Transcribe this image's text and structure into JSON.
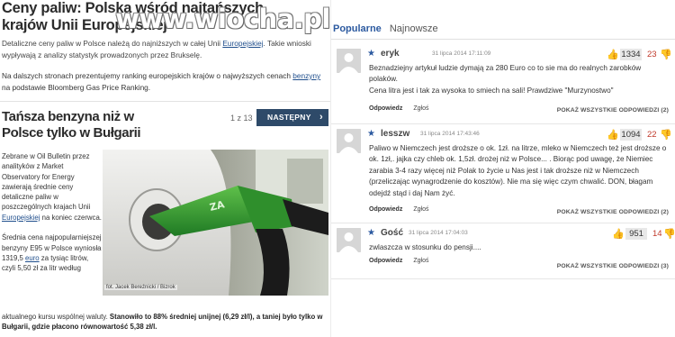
{
  "article": {
    "title": "Ceny paliw: Polska wśród najtańszych krajów Unii Europejskiej",
    "lead_pre": "Detaliczne ceny paliw w Polsce należą do najniższych w całej Unii ",
    "lead_link": "Europejskiej",
    "lead_post": ". Takie wnioski wypływają z analizy statystyk prowadzonych przez Brukselę.",
    "lead2_pre": "Na dalszych stronach prezentujemy ranking europejskich krajów o najwyższych cenach ",
    "lead2_link": "benzyny",
    "lead2_post": " na podstawie Bloomberg Gas Price Ranking.",
    "subtitle": "Tańsza benzyna niż w Polsce tylko w Bułgarii",
    "pager": "1 z 13",
    "next_label": "NASTĘPNY",
    "next_chevron": "›",
    "side_text_1": "Zebrane w Oil Bulletin przez analityków z Market Observatory for Energy zawierają średnie ceny detaliczne paliw w poszczególnych krajach Unii ",
    "side_link": "Europejskiej",
    "side_text_2": " na koniec czerwca.",
    "side_text_3": "Średnia cena najpopularniejszej benzyny E95 w Polsce wyniosła 1319,5 ",
    "side_link_2": "euro",
    "side_text_4": " za tysiąc litrów, czyli 5,50 zł za litr według",
    "bottom_pre": "aktualnego kursu wspólnej waluty. ",
    "bottom_bold": "Stanowiło to 88% średniej unijnej (6,29 zł/l), a taniej było tylko w Bułgarii, gdzie płacono równowartość 5,38 zł/l.",
    "photo_credit": "fot. Jacek Bereźnicki / Bizrok",
    "nozzle_brand": "ZA"
  },
  "watermark": "www.wiocha.pl",
  "comments_panel": {
    "tabs": [
      {
        "label": "Popularne"
      },
      {
        "label": "Najnowsze"
      }
    ],
    "reply_label": "Odpowiedz",
    "report_label": "Zgłoś",
    "show_all_label": "POKAŻ WSZYSTKIE ODPOWIEDZI",
    "comments": [
      {
        "star": "★",
        "author": "eryk",
        "date": "31 lipca 2014 17:11:09",
        "up": "1334",
        "down": "23",
        "body": "Beznadziejny artykuł ludzie dymają za 280 Euro co to sie ma do realnych zarobków polaków.\nCena litra jest i tak za wysoka to smiech na sali! Prawdziwe \"Murzynostwo\"",
        "replies": "(2)"
      },
      {
        "star": "★",
        "author": "lesszw",
        "date": "31 lipca 2014 17:43:46",
        "up": "1094",
        "down": "22",
        "body": "Paliwo w Niemczech jest droższe o ok. 1zł. na litrze, mleko w Niemczech też jest droższe o ok. 1zł,. jajka czy chleb ok. 1,5zł. drożej niż w Polsce... . Biorąc pod uwagę, że Niemiec zarabia 3-4 razy więcej niż Polak to życie u Nas jest i tak droższe niż w Niemczech (przeliczając wynagrodzenie do kosztów). Nie ma się więc czym chwalić. DON, błagam odejdź stąd i daj Nam żyć.",
        "replies": "(2)"
      },
      {
        "star": "★",
        "author": "Gość",
        "date": "31 lipca 2014 17:04:03",
        "up": "951",
        "down": "14",
        "body": "zwlaszcza w stosunku do pensji....",
        "replies": "(3)"
      }
    ]
  },
  "colors": {
    "accent_blue": "#2c5aa0",
    "button_navy": "#2e4a69",
    "down_red": "#c0392b"
  },
  "icons": {
    "thumb_up": "👍",
    "thumb_down": "👎"
  }
}
